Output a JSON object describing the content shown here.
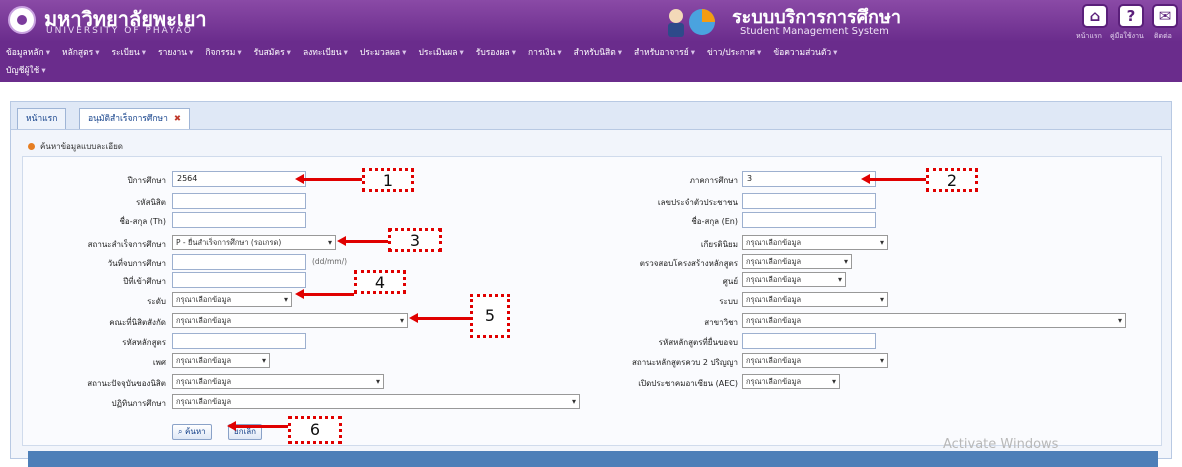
{
  "header": {
    "university_th": "มหาวิทยาลัยพะเยา",
    "university_en": "UNIVERSITY OF PHAYAO",
    "system_th": "ระบบบริการการศึกษา",
    "system_en": "Student Management System",
    "icons": [
      "home-icon",
      "help-icon",
      "mail-icon"
    ],
    "labels": [
      "หน้าแรก",
      "คู่มือใช้งาน",
      "ติดต่อ"
    ]
  },
  "menu": {
    "row1": [
      "ข้อมูลหลัก",
      "หลักสูตร",
      "ระเบียน",
      "รายงาน",
      "กิจกรรม",
      "รับสมัคร",
      "ลงทะเบียน",
      "ประมวลผล",
      "ประเมินผล",
      "รับรองผล",
      "การเงิน",
      "สำหรับนิสิต",
      "สำหรับอาจารย์",
      "ข่าว/ประกาศ",
      "ข้อความส่วนตัว"
    ],
    "row2": [
      "บัญชีผู้ใช้"
    ]
  },
  "tabs": [
    {
      "label": "หน้าแรก",
      "active": false
    },
    {
      "label": "อนุมัติสำเร็จการศึกษา",
      "active": true
    }
  ],
  "section_title": "ค้นหาข้อมูลแบบละเอียด",
  "form": {
    "year_label": "ปีการศึกษา",
    "year_value": "2564",
    "semester_label": "ภาคการศึกษา",
    "semester_value": "3",
    "student_id_label": "รหัสนิสิต",
    "national_id_label": "เลขประจำตัวประชาชน",
    "name_th_label": "ชื่อ-สกุล (Th)",
    "name_en_label": "ชื่อ-สกุล (En)",
    "grad_status_label": "สถานะสำเร็จการศึกษา",
    "grad_status_value": "P - ยื่นสำเร็จการศึกษา (รอเกรด)",
    "honor_label": "เกียรตินิยม",
    "honor_value": "กรุณาเลือกข้อมูล",
    "grad_date_label": "วันที่จบการศึกษา",
    "date_hint": "(dd/mm/)",
    "curriculum_check_label": "ตรวจสอบโครงสร้างหลักสูตร",
    "curriculum_check_value": "กรุณาเลือกข้อมูล",
    "entry_year_label": "ปีที่เข้าศึกษา",
    "center_label": "ศูนย์",
    "center_value": "กรุณาเลือกข้อมูล",
    "level_label": "ระดับ",
    "level_value": "กรุณาเลือกข้อมูล",
    "system_label": "ระบบ",
    "system_value": "กรุณาเลือกข้อมูล",
    "faculty_label": "คณะที่นิสิตสังกัด",
    "faculty_value": "กรุณาเลือกข้อมูล",
    "major_label": "สาขาวิชา",
    "major_value": "กรุณาเลือกข้อมูล",
    "curriculum_code_label": "รหัสหลักสูตร",
    "submit_curriculum_label": "รหัสหลักสูตรที่ยื่นขอจบ",
    "gender_label": "เพศ",
    "gender_value": "กรุณาเลือกข้อมูล",
    "dual_degree_label": "สถานะหลักสูตรควบ 2 ปริญญา",
    "dual_degree_value": "กรุณาเลือกข้อมูล",
    "current_status_label": "สถานะปัจจุบันของนิสิต",
    "current_status_value": "กรุณาเลือกข้อมูล",
    "aec_label": "เปิดประชาคมอาเซียน (AEC)",
    "aec_value": "กรุณาเลือกข้อมูล",
    "calendar_label": "ปฏิทินการศึกษา",
    "calendar_value": "กรุณาเลือกข้อมูล"
  },
  "buttons": {
    "search": "ค้นหา",
    "cancel": "ยกเลิก"
  },
  "annotations": [
    "1",
    "2",
    "3",
    "4",
    "5",
    "6"
  ],
  "overlay": {
    "activate": "Activate Windows"
  },
  "colors": {
    "header": "#6a2c8c",
    "arrow": "#e00000",
    "tab_bar": "#dfe8f6"
  }
}
